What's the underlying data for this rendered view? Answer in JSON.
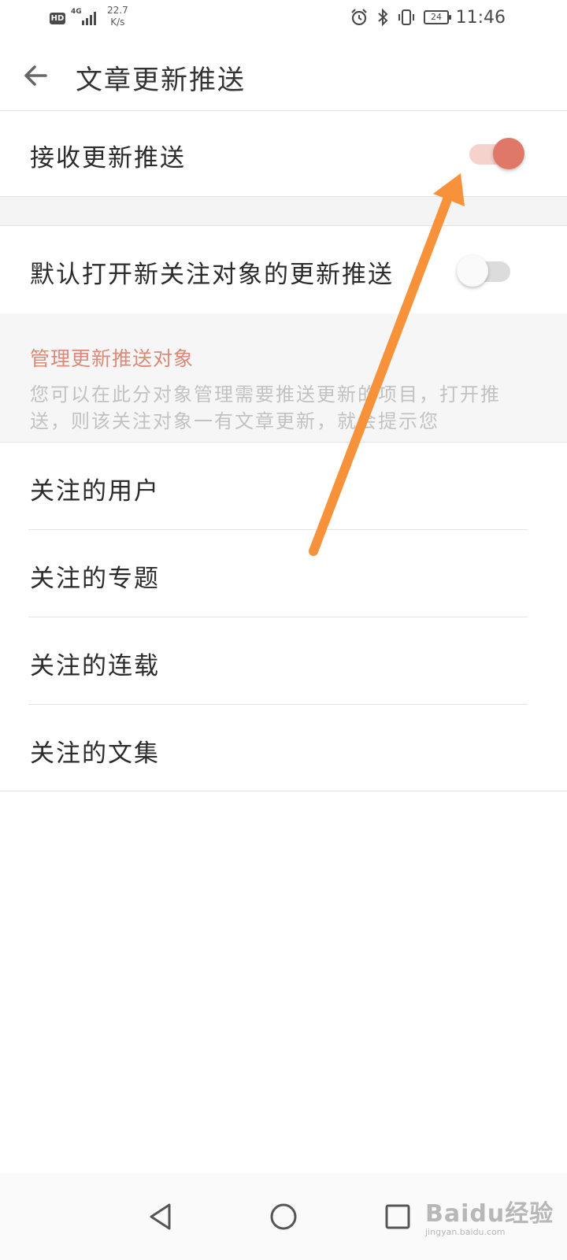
{
  "status_bar": {
    "hd": "HD",
    "network": "4G",
    "speed_value": "22.7",
    "speed_unit": "K/s",
    "battery": "24",
    "time": "11:46",
    "icons": [
      "alarm-icon",
      "bluetooth-icon",
      "vibrate-icon",
      "battery-icon"
    ]
  },
  "header": {
    "title": "文章更新推送",
    "back_icon": "back-arrow-icon"
  },
  "settings": {
    "receive_push": {
      "label": "接收更新推送",
      "enabled": true
    },
    "default_push_new_follow": {
      "label": "默认打开新关注对象的更新推送",
      "enabled": false
    }
  },
  "manage_section": {
    "title": "管理更新推送对象",
    "description": "您可以在此分对象管理需要推送更新的项目，打开推送，则该关注对象一有文章更新，就会提示您"
  },
  "list": {
    "items": [
      {
        "label": "关注的用户"
      },
      {
        "label": "关注的专题"
      },
      {
        "label": "关注的连载"
      },
      {
        "label": "关注的文集"
      }
    ]
  },
  "nav_bar": {
    "icons": [
      "back-triangle-icon",
      "home-circle-icon",
      "recents-square-icon"
    ]
  },
  "watermark": {
    "main": "Baidu经验",
    "sub": "jingyan.baidu.com"
  },
  "colors": {
    "accent": "#e0786a",
    "accent_track": "#f5d2cc",
    "section_title": "#d98a78",
    "arrow": "#f7923a"
  }
}
